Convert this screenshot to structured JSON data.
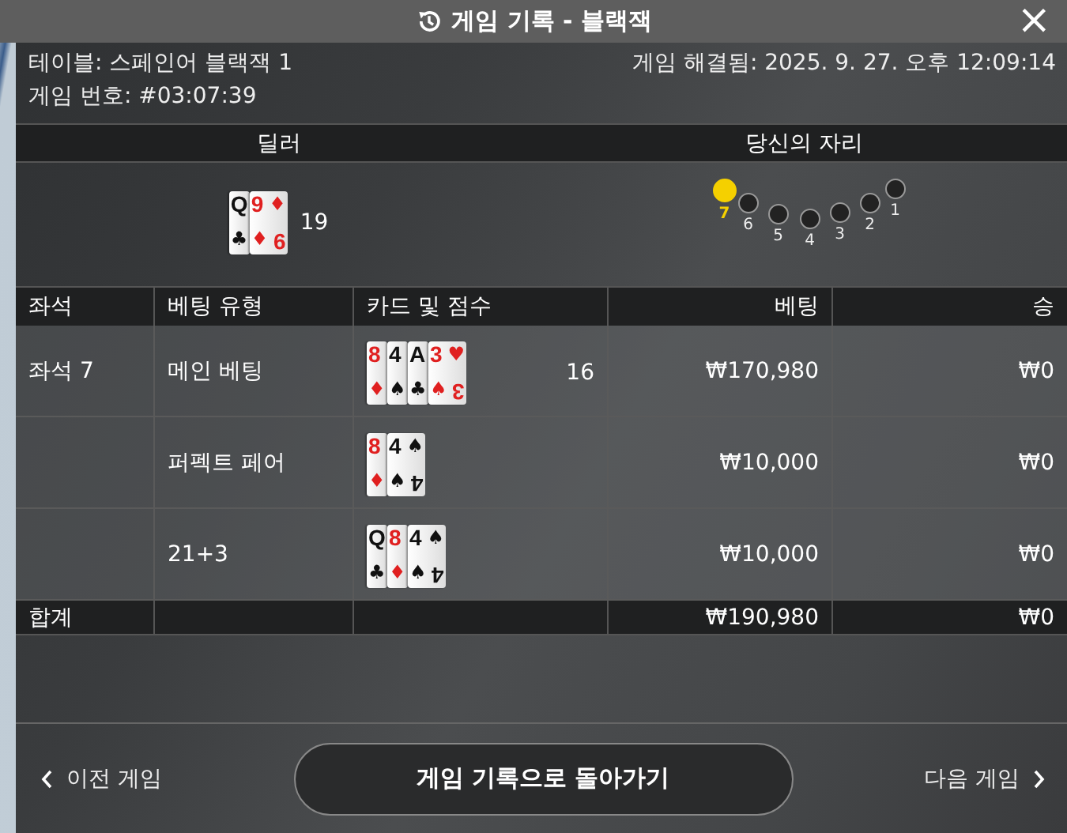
{
  "window": {
    "title": "게임 기록 - 블랙잭",
    "close": "×"
  },
  "info": {
    "table": "테이블: 스페인어 블랙잭 1",
    "resolved": "게임 해결됨: 2025. 9. 27. 오후 12:09:14",
    "game_number": "게임 번호: #03:07:39"
  },
  "dealer": {
    "heading": "딜러",
    "cards": [
      {
        "rank": "Q",
        "suit": "♣",
        "red": false
      },
      {
        "rank": "9",
        "suit": "♦",
        "red": true,
        "corner_suit": "♦",
        "corner_rank": "9"
      }
    ],
    "score": "19"
  },
  "seats": {
    "heading": "당신의 자리",
    "items": [
      {
        "label": "7",
        "selected": true
      },
      {
        "label": "6",
        "selected": false
      },
      {
        "label": "5",
        "selected": false
      },
      {
        "label": "4",
        "selected": false
      },
      {
        "label": "3",
        "selected": false
      },
      {
        "label": "2",
        "selected": false
      },
      {
        "label": "1",
        "selected": false
      }
    ]
  },
  "table": {
    "columns": [
      "좌석",
      "베팅 유형",
      "카드 및 점수",
      "베팅",
      "승"
    ],
    "rows": [
      {
        "seat": "좌석 7",
        "bet_type": "메인 베팅",
        "cards": [
          {
            "rank": "8",
            "suit": "♦",
            "red": true
          },
          {
            "rank": "4",
            "suit": "♠",
            "red": false
          },
          {
            "rank": "A",
            "suit": "♣",
            "red": false
          },
          {
            "rank": "3",
            "suit": "♠",
            "red": true,
            "corner_suit": "♥",
            "corner_rank": "3"
          }
        ],
        "score": "16",
        "bet": "₩170,980",
        "win": "₩0"
      },
      {
        "bet_type": "퍼펙트 페어",
        "cards": [
          {
            "rank": "8",
            "suit": "♦",
            "red": true
          },
          {
            "rank": "4",
            "suit": "♠",
            "red": false,
            "corner_suit": "♠",
            "corner_rank": "4"
          }
        ],
        "bet": "₩10,000",
        "win": "₩0"
      },
      {
        "bet_type": "21+3",
        "cards": [
          {
            "rank": "Q",
            "suit": "♣",
            "red": false
          },
          {
            "rank": "8",
            "suit": "♦",
            "red": true
          },
          {
            "rank": "4",
            "suit": "♠",
            "red": false,
            "corner_suit": "♠",
            "corner_rank": "4"
          }
        ],
        "bet": "₩10,000",
        "win": "₩0"
      }
    ],
    "total": {
      "label": "합계",
      "bet": "₩190,980",
      "win": "₩0"
    }
  },
  "footer": {
    "previous": "이전 게임",
    "back": "게임 기록으로 돌아가기",
    "next": "다음 게임"
  }
}
